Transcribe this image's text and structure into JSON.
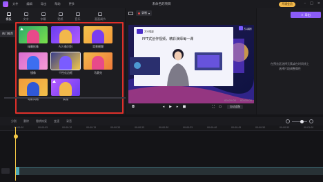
{
  "app": {
    "menu": [
      "文件",
      "编辑",
      "导出",
      "帮助",
      "更多"
    ],
    "title": "未命名的项目",
    "vip_label": "开通会员"
  },
  "left_panel": {
    "tabs": [
      {
        "label": "模板"
      },
      {
        "label": "文字"
      },
      {
        "label": "字幕"
      },
      {
        "label": "贴纸"
      },
      {
        "label": "音乐"
      },
      {
        "label": "画面调节"
      }
    ],
    "category": "热门推荐",
    "templates": [
      {
        "label": "绿幕抠像",
        "colors": [
          "#2aa96b",
          "#7be04a"
        ],
        "fig": "#e84a8a",
        "starred": true
      },
      {
        "label": "AI人像识别",
        "colors": [
          "#6a3df0",
          "#b15cff"
        ],
        "fig": "#f2b84b",
        "starred": false
      },
      {
        "label": "背景模糊",
        "colors": [
          "#f2c14b",
          "#f59b3a"
        ],
        "fig": "#7a3df0",
        "starred": false
      },
      {
        "label": "镜像",
        "colors": [
          "#d86bd0",
          "#f59bd6"
        ],
        "fig": "#3d6ef0",
        "starred": false
      },
      {
        "label": "个性化边框",
        "colors": [
          "#3a3f8a",
          "#f0c64b"
        ],
        "fig": "#7a5cff",
        "starred": false
      },
      {
        "label": "马赛克",
        "colors": [
          "#f2b84b",
          "#f07a3a"
        ],
        "fig": "#e84a8a",
        "starred": false
      },
      {
        "label": "电影风格",
        "colors": [
          "#f29b3a",
          "#f2c14b"
        ],
        "fig": "#2f58d6",
        "starred": false
      },
      {
        "label": "素描",
        "colors": [
          "#b85cff",
          "#6a3df0"
        ],
        "fig": "#f2b84b",
        "starred": true
      }
    ]
  },
  "player": {
    "record_label": "录制",
    "screen": {
      "brand": "万兴喵影",
      "headline": "PPT式创作视频，精彩演绎每一课",
      "corner_brand": "万兴喵影"
    },
    "time_current": "00:00:00",
    "time_total": "00:00:00",
    "ratio_label": "自动适配"
  },
  "inspector": {
    "export_label": "导出",
    "hint_line1": "在预览区选择元素或在时间线上",
    "hint_line2": "选择片段调整属性"
  },
  "toolbar": {
    "items": [
      "分割",
      "删除",
      "撤销恢复",
      "变速",
      "录音"
    ]
  },
  "ruler": {
    "ticks": [
      "00:00:00",
      "00:00:05",
      "00:00:10",
      "00:00:15",
      "00:00:20",
      "00:00:25",
      "00:00:30",
      "00:00:35",
      "00:00:40",
      "00:00:45",
      "00:00:50",
      "00:00:55",
      "00:01:00"
    ]
  },
  "colors": {
    "accent": "#8b5cf6",
    "highlight_border": "#e0302a",
    "playhead": "#f5c945"
  }
}
